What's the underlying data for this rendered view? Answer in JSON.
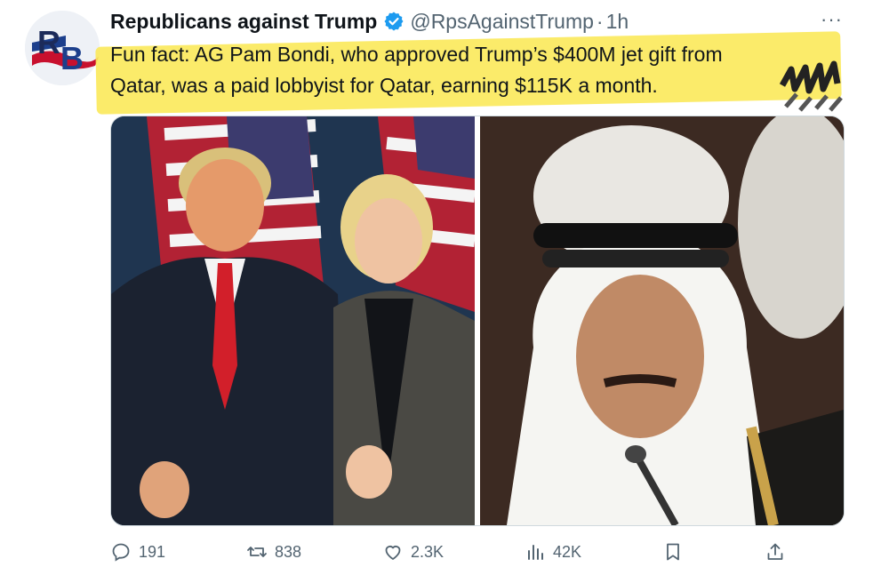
{
  "author": {
    "name": "Republicans against Trump",
    "handle": "@RpsAgainstTrump",
    "separator": "·",
    "time": "1h",
    "avatar_text": "RB",
    "verified_icon": "verified-badge-icon"
  },
  "tweet": {
    "text": "Fun fact: AG Pam Bondi, who approved Trump’s $400M jet gift from\nQatar, was a paid lobbyist for Qatar, earning $115K a month.",
    "highlight_color": "#fbe95a"
  },
  "more_label": "···",
  "media": [
    {
      "icon": "photo-left"
    },
    {
      "icon": "photo-right"
    }
  ],
  "actions": {
    "reply": {
      "icon": "reply-icon",
      "count": "191"
    },
    "repost": {
      "icon": "repost-icon",
      "count": "838"
    },
    "like": {
      "icon": "like-icon",
      "count": "2.3K"
    },
    "views": {
      "icon": "views-icon",
      "count": "42K"
    },
    "bookmark": {
      "icon": "bookmark-icon"
    },
    "share": {
      "icon": "share-icon"
    }
  },
  "colors": {
    "text": "#0f1419",
    "secondary": "#536471",
    "verified": "#1d9bf0"
  }
}
